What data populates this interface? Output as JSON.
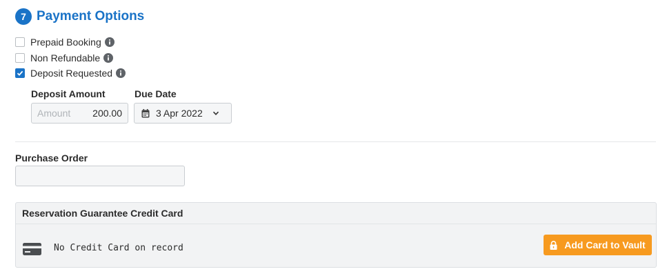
{
  "section": {
    "step_number": "7",
    "title": "Payment Options"
  },
  "options": [
    {
      "label": "Prepaid Booking",
      "checked": false,
      "info_icon": "info-icon"
    },
    {
      "label": "Non Refundable",
      "checked": false,
      "info_icon": "info-icon"
    },
    {
      "label": "Deposit Requested",
      "checked": true,
      "info_icon": "info-icon"
    }
  ],
  "deposit": {
    "amount_label": "Deposit Amount",
    "amount_placeholder": "Amount",
    "amount_value": "200.00",
    "due_date_label": "Due Date",
    "due_date_value": "3 Apr 2022",
    "calendar_icon": "calendar-icon",
    "dropdown_icon": "chevron-down-icon"
  },
  "purchase_order": {
    "label": "Purchase Order",
    "value": ""
  },
  "credit_card": {
    "header": "Reservation Guarantee Credit Card",
    "card_icon": "credit-card-icon",
    "status_text": "No Credit Card on record",
    "add_button_label": "Add Card to Vault",
    "add_button_icon": "lock-icon"
  },
  "colors": {
    "accent": "#1a73c7",
    "button_orange": "#f79a1f",
    "panel_bg": "#f2f3f4"
  }
}
